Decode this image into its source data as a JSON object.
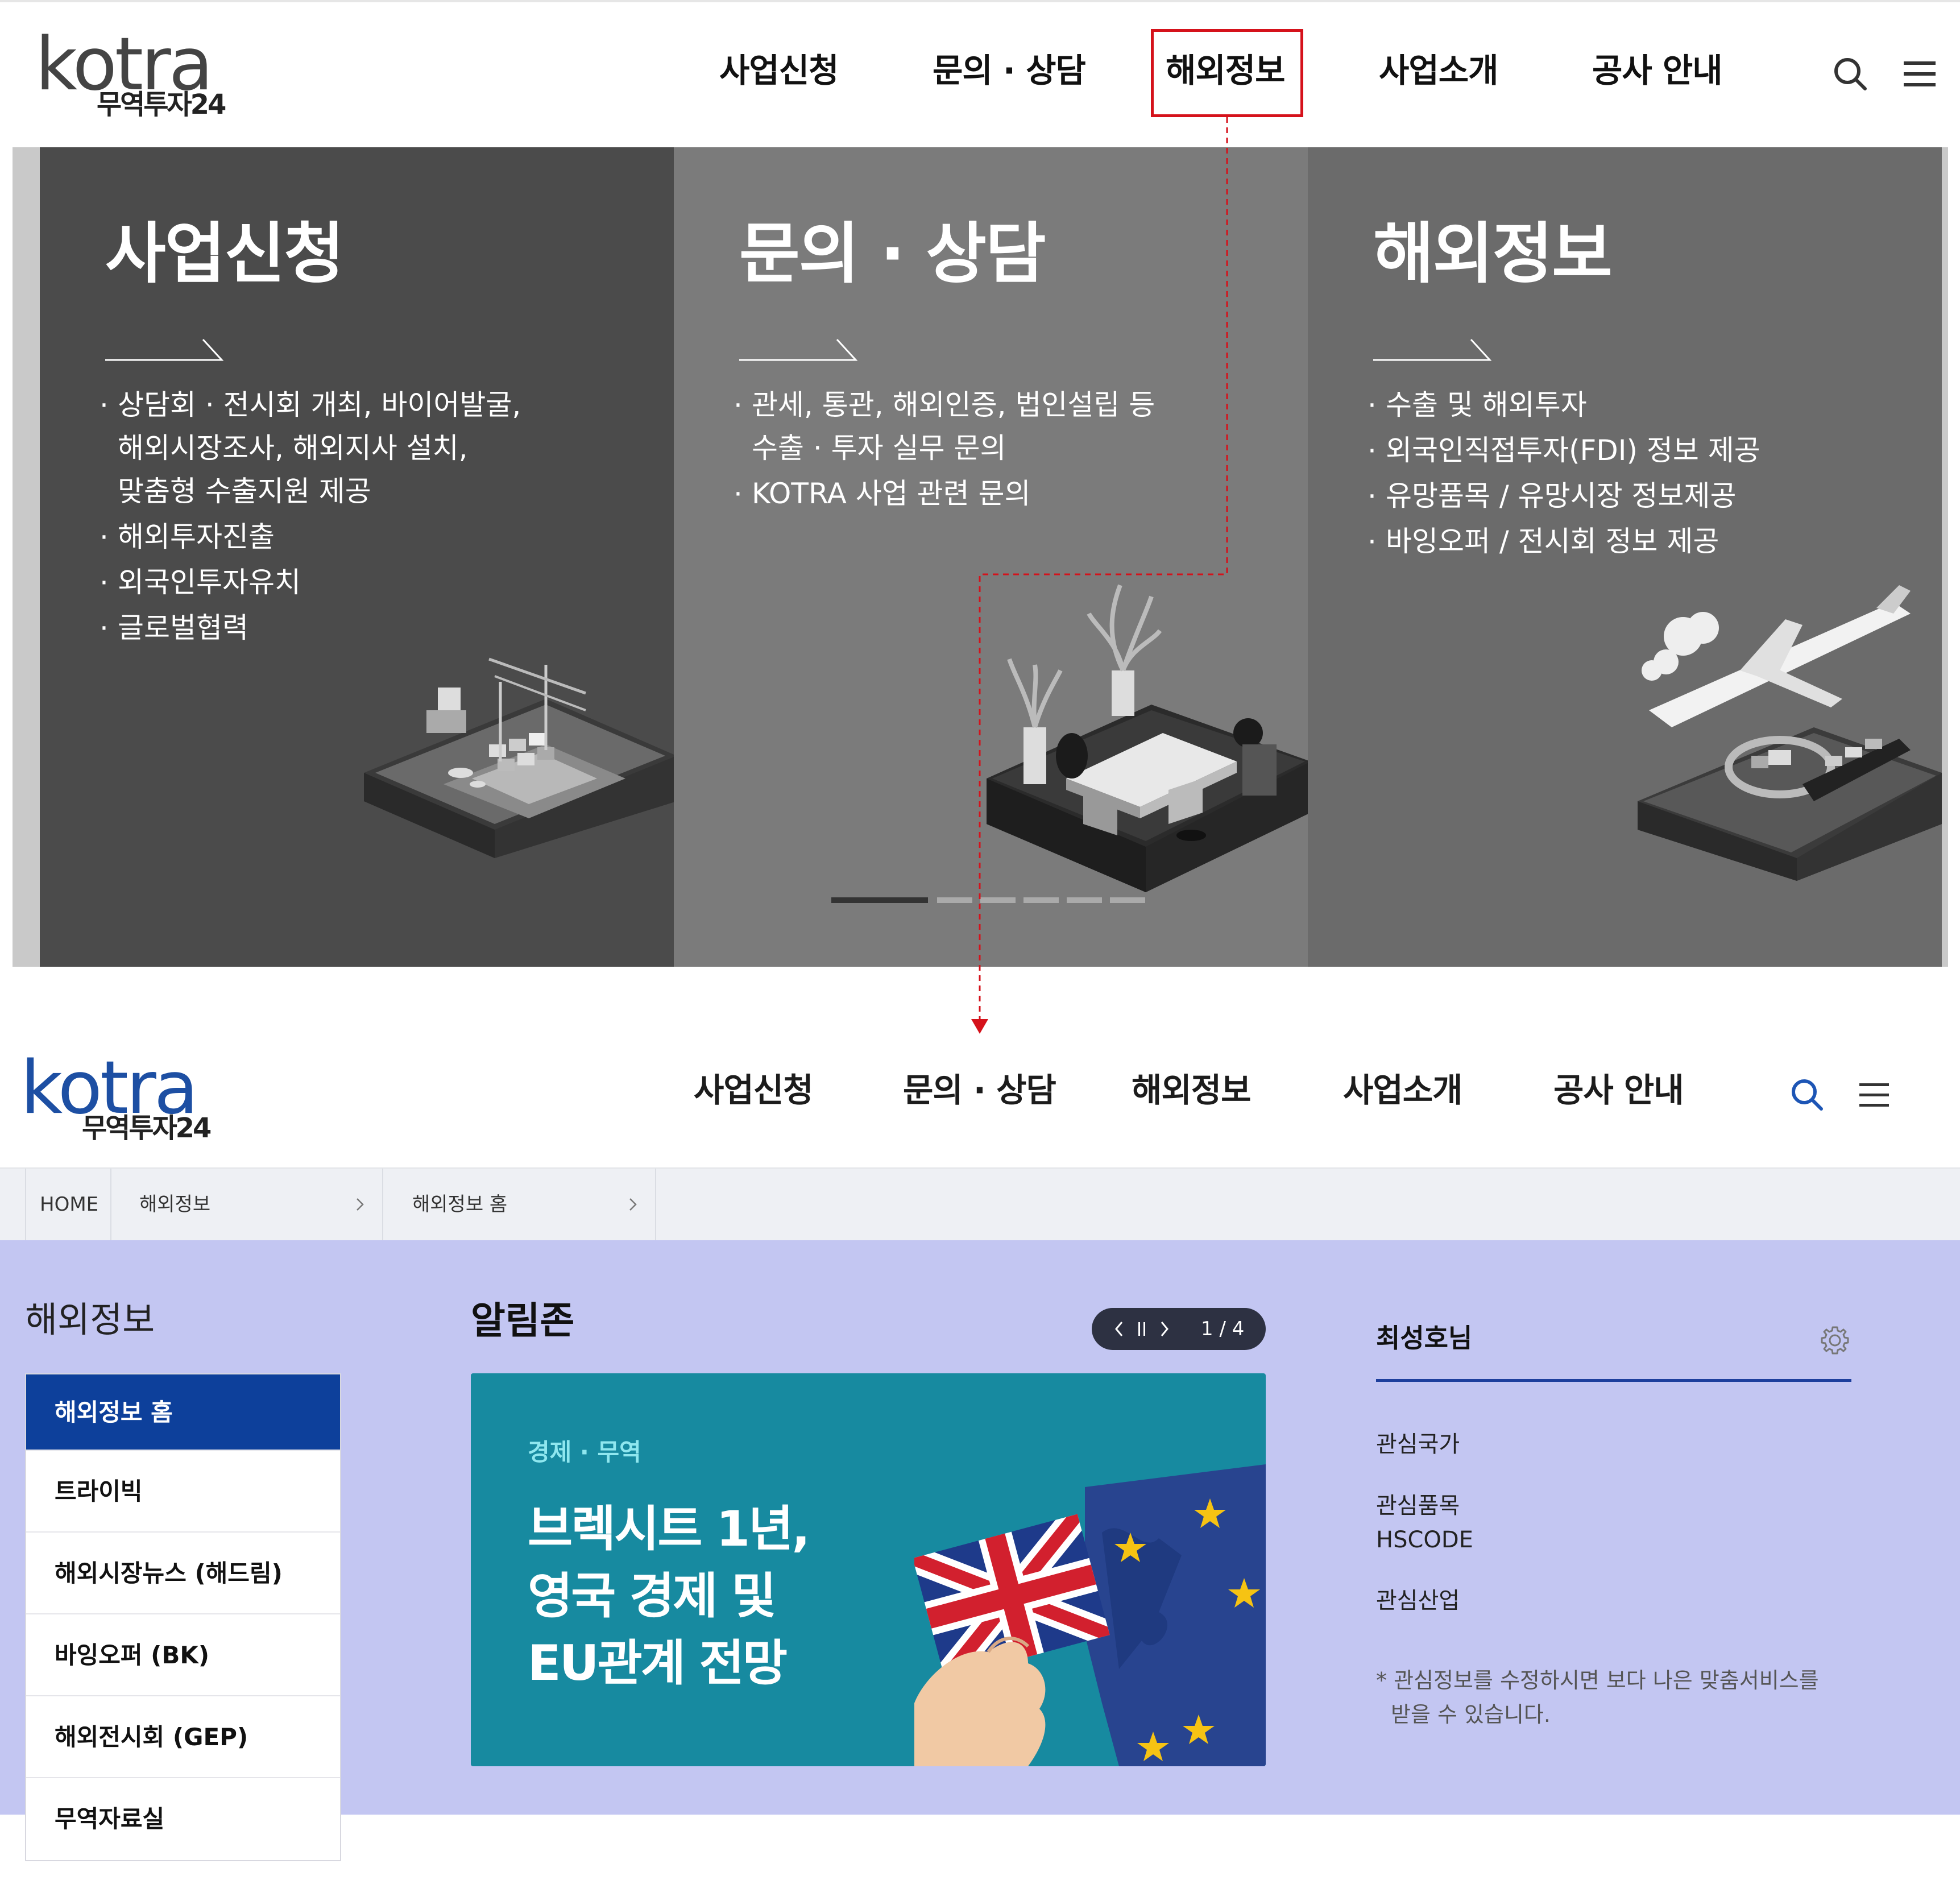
{
  "top_screen": {
    "logo": {
      "wordmark": "kotra",
      "sub": "무역투자24"
    },
    "nav": [
      "사업신청",
      "문의 · 상담",
      "해외정보",
      "사업소개",
      "공사 안내"
    ],
    "highlighted_nav": "해외정보",
    "icons": [
      "search-icon",
      "menu-icon"
    ],
    "panels": [
      {
        "title": "사업신청",
        "items": [
          {
            "line1": "상담회 · 전시회 개최, 바이어발굴,",
            "line2": "해외시장조사, 해외지사 설치,",
            "line3": "맞춤형 수출지원 제공"
          },
          {
            "line1": "해외투자진출"
          },
          {
            "line1": "외국인투자유치"
          },
          {
            "line1": "글로벌협력"
          }
        ]
      },
      {
        "title": "문의 · 상담",
        "items": [
          {
            "line1": "관세, 통관, 해외인증, 법인설립 등",
            "line2": "수출 · 투자 실무 문의"
          },
          {
            "line1": "KOTRA 사업 관련 문의"
          }
        ]
      },
      {
        "title": "해외정보",
        "items": [
          {
            "line1": "수출 및 해외투자"
          },
          {
            "line1": "외국인직접투자(FDI) 정보 제공"
          },
          {
            "line1": "유망품목 / 유망시장 정보제공"
          },
          {
            "line1": "바잉오퍼 / 전시회 정보 제공"
          }
        ]
      }
    ],
    "carousel": {
      "total": 6,
      "active": 1
    }
  },
  "bottom_screen": {
    "logo": {
      "wordmark": "kotra",
      "sub": "무역투자24"
    },
    "nav": [
      "사업신청",
      "문의 · 상담",
      "해외정보",
      "사업소개",
      "공사 안내"
    ],
    "breadcrumb": [
      "HOME",
      "해외정보",
      "해외정보 홈"
    ],
    "sidebar": {
      "title": "해외정보",
      "items": [
        "해외정보 홈",
        "트라이빅",
        "해외시장뉴스 (해드림)",
        "바잉오퍼 (BK)",
        "해외전시회 (GEP)",
        "무역자료실"
      ],
      "active_index": 0
    },
    "notice": {
      "title": "알림존",
      "pager": "1 / 4",
      "banner": {
        "category": "경제 · 무역",
        "headline": [
          "브렉시트 1년,",
          "영국 경제 및",
          "EU관계 전망"
        ]
      }
    },
    "user": {
      "name": "최성호님",
      "labels": [
        "관심국가",
        "관심품목",
        "HSCODE",
        "관심산업"
      ],
      "note": [
        "* 관심정보를 수정하시면 보다 나은 맞춤서비스를",
        "받을 수 있습니다."
      ]
    }
  },
  "colors": {
    "highlight_box": "#d5121b",
    "arrow": "#d5121b",
    "active_menu": "#0d409b",
    "lavender_bg": "#c3c6f2",
    "banner_bg": "#178aa0",
    "logo_blue": "#1d4fa3"
  }
}
